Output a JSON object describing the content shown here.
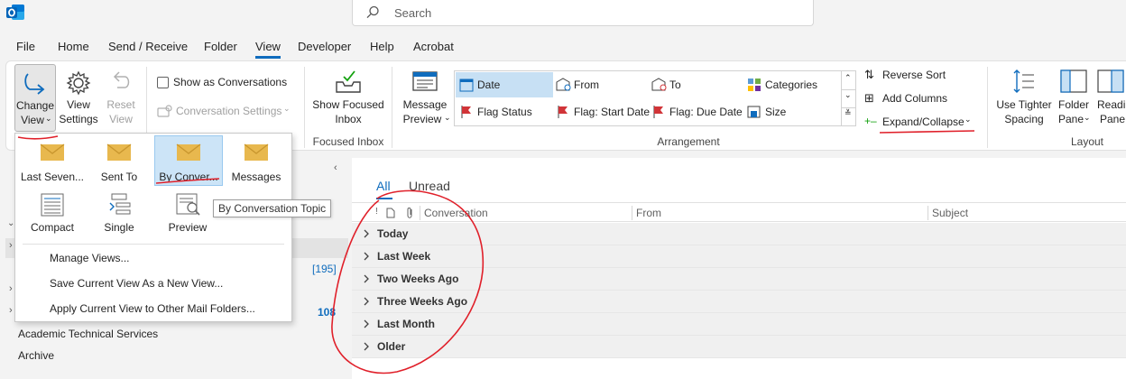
{
  "search": {
    "placeholder": "Search"
  },
  "menu": {
    "tabs": [
      "File",
      "Home",
      "Send / Receive",
      "Folder",
      "View",
      "Developer",
      "Help",
      "Acrobat"
    ],
    "active": "View"
  },
  "ribbon": {
    "current_view": {
      "change_view_line1": "Change",
      "change_view_line2": "View",
      "view_settings_line1": "View",
      "view_settings_line2": "Settings",
      "reset_view_line1": "Reset",
      "reset_view_line2": "View"
    },
    "messages": {
      "show_as_conversations": "Show as Conversations",
      "show_as_conversations_checked": false,
      "conversation_settings": "Conversation Settings"
    },
    "focused_inbox": {
      "button_line1": "Show Focused",
      "button_line2": "Inbox",
      "group_label": "Focused Inbox"
    },
    "arrangement": {
      "message_preview_line1": "Message",
      "message_preview_line2": "Preview",
      "items": [
        "Date",
        "From",
        "To",
        "Categories",
        "Flag Status",
        "Flag: Start Date",
        "Flag: Due Date",
        "Size"
      ],
      "selected": "Date",
      "reverse_sort": "Reverse Sort",
      "add_columns": "Add Columns",
      "expand_collapse": "Expand/Collapse",
      "group_label": "Arrangement"
    },
    "layout": {
      "tighter_spacing_line1": "Use Tighter",
      "tighter_spacing_line2": "Spacing",
      "folder_pane_line1": "Folder",
      "folder_pane_line2": "Pane",
      "reading_pane_line1": "Readin",
      "reading_pane_line2": "Pane",
      "group_label": "Layout"
    }
  },
  "view_dropdown": {
    "views": [
      "Last Seven...",
      "Sent To",
      "By Conver...",
      "Messages",
      "Compact",
      "Single",
      "Preview"
    ],
    "selected": "By Conver...",
    "commands": [
      "Manage Views...",
      "Save Current View As a New View...",
      "Apply Current View to Other Mail Folders..."
    ]
  },
  "tooltip": "By Conversation Topic",
  "folders": {
    "count_195": "[195]",
    "count_108": "108",
    "items": [
      "Academic Technical Services",
      "Archive"
    ]
  },
  "message_list": {
    "filter_tabs": [
      "All",
      "Unread"
    ],
    "active_filter": "All",
    "columns": [
      "Conversation",
      "From",
      "Subject"
    ],
    "groups": [
      "Today",
      "Last Week",
      "Two Weeks Ago",
      "Three Weeks Ago",
      "Last Month",
      "Older"
    ]
  },
  "colors": {
    "accent": "#0f6cbd",
    "annotation": "#e0202a",
    "selection": "#cce4f7"
  }
}
